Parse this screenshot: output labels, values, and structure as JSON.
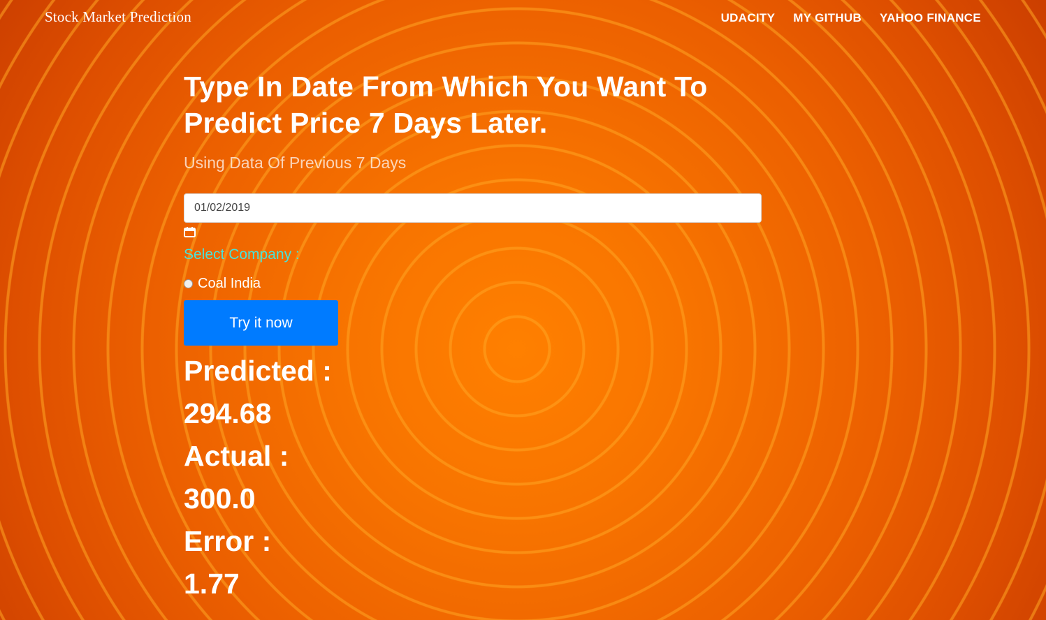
{
  "header": {
    "brand": "Stock Market Prediction",
    "nav": [
      "UDACITY",
      "MY GITHUB",
      "YAHOO FINANCE"
    ]
  },
  "main": {
    "headline_line1": "Type In Date From Which You Want To",
    "headline_line2": "Predict Price 7 Days Later.",
    "subheadline": "Using Data Of Previous 7 Days",
    "date_value": "01/02/2019",
    "calendar_icon": "calendar-icon",
    "select_label": "Select Company :",
    "company_option": "Coal India",
    "button_label": "Try it now"
  },
  "results": {
    "predicted_label": "Predicted :",
    "predicted_value": "294.68",
    "actual_label": "Actual :",
    "actual_value": "300.0",
    "error_label": "Error :",
    "error_value": "1.77"
  },
  "colors": {
    "accent_button": "#007bff",
    "select_label": "#48e3d8",
    "background_center": "#ff8000",
    "background_edge": "#cc3f00"
  }
}
